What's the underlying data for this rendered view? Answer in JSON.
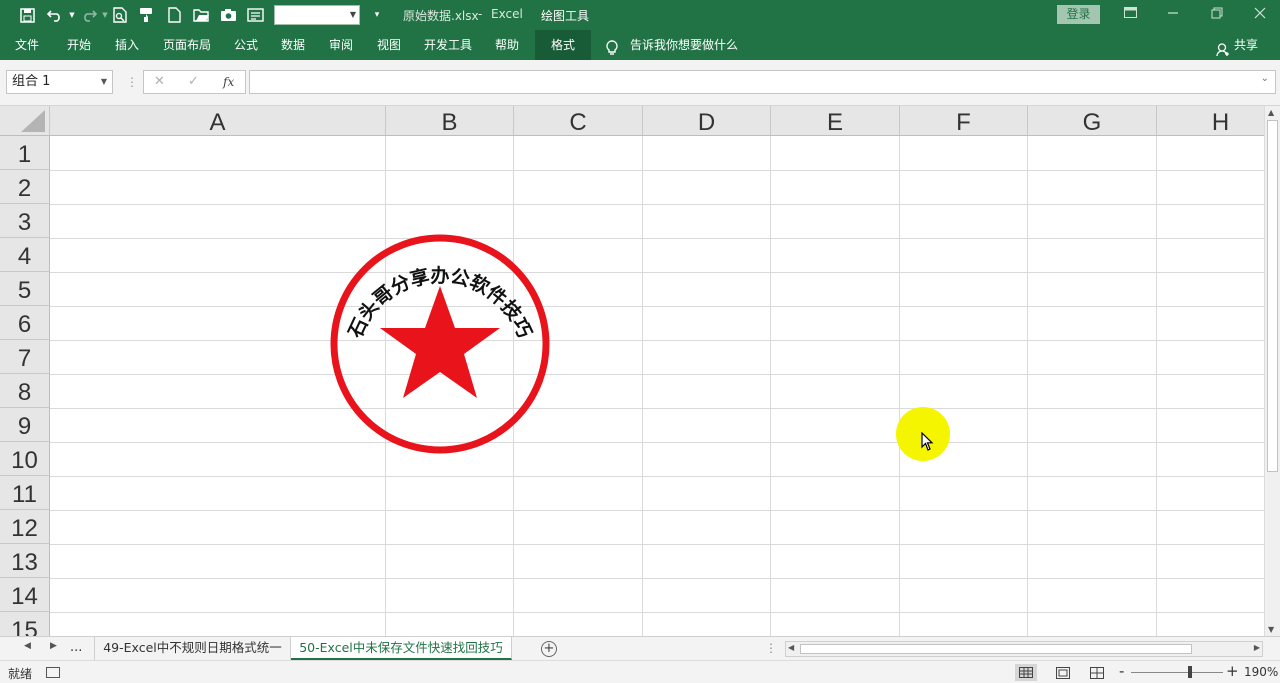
{
  "titlebar": {
    "filename": "原始数据.xlsx",
    "separator": "-",
    "app": "Excel",
    "context_tool": "绘图工具",
    "login": "登录"
  },
  "ribbon": {
    "tabs": [
      "文件",
      "开始",
      "插入",
      "页面布局",
      "公式",
      "数据",
      "审阅",
      "视图",
      "开发工具",
      "帮助",
      "格式"
    ],
    "tell_me": "告诉我你想要做什么",
    "share": "共享"
  },
  "formula_bar": {
    "name_box": "组合 1",
    "cancel": "✕",
    "enter": "✓",
    "fx": "fx",
    "formula": ""
  },
  "grid": {
    "columns": [
      "A",
      "B",
      "C",
      "D",
      "E",
      "F",
      "G",
      "H"
    ],
    "rows": [
      "1",
      "2",
      "3",
      "4",
      "5",
      "6",
      "7",
      "8",
      "9",
      "10",
      "11",
      "12",
      "13",
      "14",
      "15"
    ]
  },
  "stamp": {
    "text": "石头哥分享办公软件技巧",
    "color": "#e8131b"
  },
  "sheets": {
    "ellipsis": "...",
    "tabs": [
      "49-Excel中不规则日期格式统一",
      "50-Excel中未保存文件快速找回技巧"
    ],
    "active_index": 1,
    "add": "+"
  },
  "status": {
    "ready": "就绪",
    "zoom": "190%",
    "zoom_minus": "-",
    "zoom_plus": "+"
  },
  "colors": {
    "accent": "#217346",
    "cursor_highlight": "#f5f500"
  },
  "icons": [
    "save-icon",
    "undo-icon",
    "redo-icon",
    "print-preview-icon",
    "format-painter-icon",
    "new-file-icon",
    "open-folder-icon",
    "camera-icon",
    "form-icon",
    "customize-icon",
    "lightbulb-icon",
    "person-icon"
  ]
}
